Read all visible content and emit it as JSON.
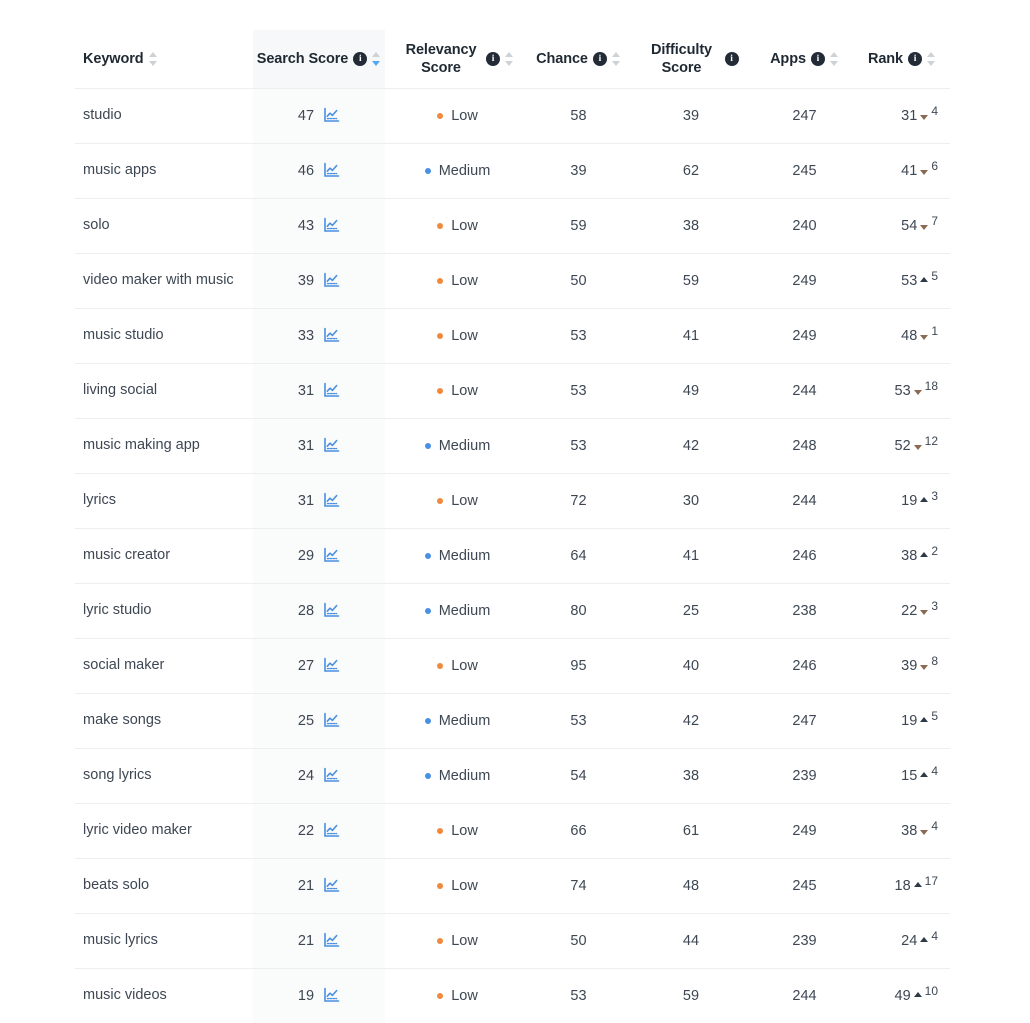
{
  "table": {
    "columns": [
      {
        "key": "keyword",
        "label": "Keyword",
        "has_info": false,
        "sortable": true,
        "sorted": "none",
        "align": "left"
      },
      {
        "key": "search",
        "label": "Search Score",
        "has_info": true,
        "sortable": true,
        "sorted": "desc",
        "align": "center"
      },
      {
        "key": "relevancy",
        "label": "Relevancy Score",
        "has_info": true,
        "sortable": true,
        "sorted": "none",
        "align": "center"
      },
      {
        "key": "chance",
        "label": "Chance",
        "has_info": true,
        "sortable": true,
        "sorted": "none",
        "align": "center"
      },
      {
        "key": "difficulty",
        "label": "Difficulty Score",
        "has_info": true,
        "sortable": false,
        "sorted": "none",
        "align": "center"
      },
      {
        "key": "apps",
        "label": "Apps",
        "has_info": true,
        "sortable": true,
        "sorted": "none",
        "align": "center"
      },
      {
        "key": "rank",
        "label": "Rank",
        "has_info": true,
        "sortable": true,
        "sorted": "none",
        "align": "center"
      }
    ],
    "info_glyph": "i",
    "chart_icon_name": "line-chart-icon",
    "rows": [
      {
        "keyword": "studio",
        "search": "47",
        "relevancy": "Low",
        "chance": "58",
        "difficulty": "39",
        "apps": "247",
        "rank": "31",
        "rank_dir": "down",
        "rank_delta": "4"
      },
      {
        "keyword": "music apps",
        "search": "46",
        "relevancy": "Medium",
        "chance": "39",
        "difficulty": "62",
        "apps": "245",
        "rank": "41",
        "rank_dir": "down",
        "rank_delta": "6"
      },
      {
        "keyword": "solo",
        "search": "43",
        "relevancy": "Low",
        "chance": "59",
        "difficulty": "38",
        "apps": "240",
        "rank": "54",
        "rank_dir": "down",
        "rank_delta": "7"
      },
      {
        "keyword": "video maker with music",
        "search": "39",
        "relevancy": "Low",
        "chance": "50",
        "difficulty": "59",
        "apps": "249",
        "rank": "53",
        "rank_dir": "up",
        "rank_delta": "5"
      },
      {
        "keyword": "music studio",
        "search": "33",
        "relevancy": "Low",
        "chance": "53",
        "difficulty": "41",
        "apps": "249",
        "rank": "48",
        "rank_dir": "down",
        "rank_delta": "1"
      },
      {
        "keyword": "living social",
        "search": "31",
        "relevancy": "Low",
        "chance": "53",
        "difficulty": "49",
        "apps": "244",
        "rank": "53",
        "rank_dir": "down",
        "rank_delta": "18"
      },
      {
        "keyword": "music making app",
        "search": "31",
        "relevancy": "Medium",
        "chance": "53",
        "difficulty": "42",
        "apps": "248",
        "rank": "52",
        "rank_dir": "down",
        "rank_delta": "12"
      },
      {
        "keyword": "lyrics",
        "search": "31",
        "relevancy": "Low",
        "chance": "72",
        "difficulty": "30",
        "apps": "244",
        "rank": "19",
        "rank_dir": "up",
        "rank_delta": "3"
      },
      {
        "keyword": "music creator",
        "search": "29",
        "relevancy": "Medium",
        "chance": "64",
        "difficulty": "41",
        "apps": "246",
        "rank": "38",
        "rank_dir": "up",
        "rank_delta": "2"
      },
      {
        "keyword": "lyric studio",
        "search": "28",
        "relevancy": "Medium",
        "chance": "80",
        "difficulty": "25",
        "apps": "238",
        "rank": "22",
        "rank_dir": "down",
        "rank_delta": "3"
      },
      {
        "keyword": "social maker",
        "search": "27",
        "relevancy": "Low",
        "chance": "95",
        "difficulty": "40",
        "apps": "246",
        "rank": "39",
        "rank_dir": "down",
        "rank_delta": "8"
      },
      {
        "keyword": "make songs",
        "search": "25",
        "relevancy": "Medium",
        "chance": "53",
        "difficulty": "42",
        "apps": "247",
        "rank": "19",
        "rank_dir": "up",
        "rank_delta": "5"
      },
      {
        "keyword": "song lyrics",
        "search": "24",
        "relevancy": "Medium",
        "chance": "54",
        "difficulty": "38",
        "apps": "239",
        "rank": "15",
        "rank_dir": "up",
        "rank_delta": "4"
      },
      {
        "keyword": "lyric video maker",
        "search": "22",
        "relevancy": "Low",
        "chance": "66",
        "difficulty": "61",
        "apps": "249",
        "rank": "38",
        "rank_dir": "down",
        "rank_delta": "4"
      },
      {
        "keyword": "beats solo",
        "search": "21",
        "relevancy": "Low",
        "chance": "74",
        "difficulty": "48",
        "apps": "245",
        "rank": "18",
        "rank_dir": "up",
        "rank_delta": "17"
      },
      {
        "keyword": "music lyrics",
        "search": "21",
        "relevancy": "Low",
        "chance": "50",
        "difficulty": "44",
        "apps": "239",
        "rank": "24",
        "rank_dir": "up",
        "rank_delta": "4"
      },
      {
        "keyword": "music videos",
        "search": "19",
        "relevancy": "Low",
        "chance": "53",
        "difficulty": "59",
        "apps": "244",
        "rank": "49",
        "rank_dir": "up",
        "rank_delta": "10"
      }
    ]
  },
  "colors": {
    "relevancy_low": "#ef8a3c",
    "relevancy_medium": "#4a90e2",
    "chart_icon": "#4a8fe0",
    "sort_active": "#54a7f2",
    "sort_inactive": "#cdd2d7",
    "rank_up": "#2f3a48",
    "rank_down": "#8a6a52",
    "text": "#3d4753",
    "header_text": "#1f2933",
    "row_border": "#eceef0",
    "sorted_col_bg": "#f7f8f9"
  }
}
